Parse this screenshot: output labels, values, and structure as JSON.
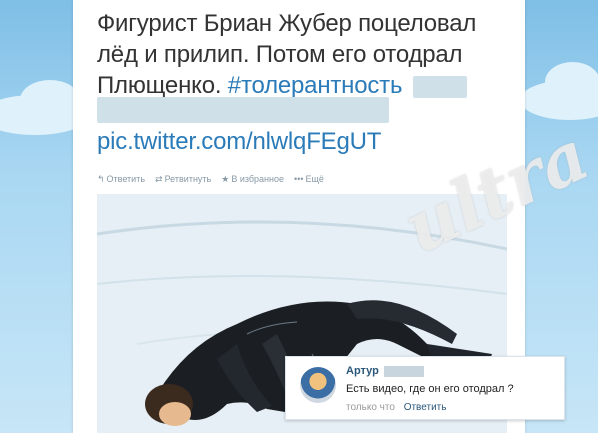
{
  "tweet": {
    "text_line1": "Фигурист Бриан Жубер поцеловал",
    "text_line2": "лёд и прилип. Потом его отодрал",
    "text_line3": "Плющенко.",
    "hashtag": "#толерантность",
    "pic_link": "pic.twitter.com/nlwlqFEgUT"
  },
  "actions": [
    {
      "icon": "reply-icon",
      "glyph": "↰",
      "label": "Ответить"
    },
    {
      "icon": "retweet-icon",
      "glyph": "⇄",
      "label": "Ретвитнуть"
    },
    {
      "icon": "star-icon",
      "glyph": "★",
      "label": "В избранное"
    },
    {
      "icon": "more-icon",
      "glyph": "•••",
      "label": "Ещё"
    }
  ],
  "comment": {
    "author": "Артур",
    "text": "Есть видео, где он его отодрал ?",
    "time": "только что",
    "reply_label": "Ответить"
  },
  "colors": {
    "link": "#2b7bb9",
    "text": "#333333",
    "vk_link": "#2b587a",
    "background": "#a9d7f2"
  }
}
